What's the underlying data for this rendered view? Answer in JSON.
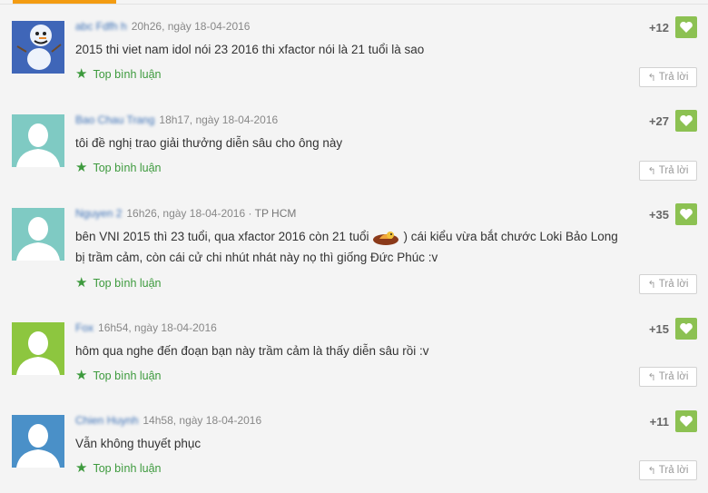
{
  "comments": [
    {
      "username": "abc Fdfh h",
      "time": "20h26, ngày 18-04-2016",
      "location": "",
      "text": "2015 thi viet nam idol nói 23 2016 thi xfactor nói là 21 tuổi là sao",
      "text_suffix": "",
      "top_label": "Top bình luận",
      "votes": "+12",
      "reply_label": "Trả lời",
      "avatar": "snowman-avatar"
    },
    {
      "username": "Bao Chau Trang",
      "time": "18h17, ngày 18-04-2016",
      "location": "",
      "text": "tôi đề nghị trao giải thưởng diễn sâu cho ông này",
      "text_suffix": "",
      "top_label": "Top bình luận",
      "votes": "+27",
      "reply_label": "Trả lời",
      "avatar": "default-user-avatar"
    },
    {
      "username": "Nguyen 2",
      "time": "16h26, ngày 18-04-2016",
      "location": "TP HCM",
      "text": "bên VNI 2015 thì 23 tuổi, qua xfactor 2016 còn 21 tuổi",
      "text_suffix": ") cái kiểu vừa bắt chước Loki Bảo Long bị trầm cảm, còn cái cử chi nhút nhát này nọ thì giống Đức Phúc :v",
      "top_label": "Top bình luận",
      "votes": "+35",
      "reply_label": "Trả lời",
      "avatar": "default-user-avatar"
    },
    {
      "username": "Fox",
      "time": "16h54, ngày 18-04-2016",
      "location": "",
      "text": "hôm qua nghe đến đoạn bạn này trầm cảm là thấy diễn sâu rồi :v",
      "text_suffix": "",
      "top_label": "Top bình luận",
      "votes": "+15",
      "reply_label": "Trả lời",
      "avatar": "default-user-avatar"
    },
    {
      "username": "Chien Huynh",
      "time": "14h58, ngày 18-04-2016",
      "location": "",
      "text": "Vẫn không thuyết phục",
      "text_suffix": "",
      "top_label": "Top bình luận",
      "votes": "+11",
      "reply_label": "Trả lời",
      "avatar": "default-user-avatar"
    }
  ],
  "colors": {
    "accent": "#f39c12",
    "like": "#8cc152",
    "top_label": "#3d9a3d",
    "avatar_teal": "#7fcac3",
    "avatar_green": "#8dc63f",
    "avatar_blue": "#4a90c8",
    "avatar_snowman_bg": "#3f66b8"
  }
}
